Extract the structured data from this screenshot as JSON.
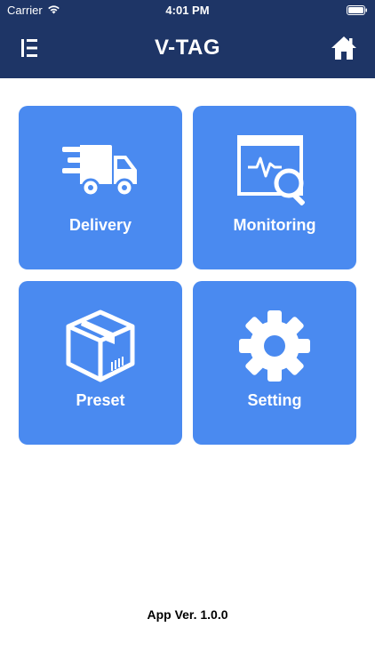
{
  "status_bar": {
    "carrier": "Carrier",
    "time": "4:01 PM",
    "wifi_icon": "wifi-icon",
    "battery_icon": "battery-icon"
  },
  "header": {
    "title": "V-TAG",
    "menu_icon": "menu-icon",
    "home_icon": "home-icon",
    "background_color": "#1e3566"
  },
  "tiles": [
    {
      "label": "Delivery",
      "icon": "truck-icon"
    },
    {
      "label": "Monitoring",
      "icon": "monitor-search-icon"
    },
    {
      "label": "Preset",
      "icon": "package-box-icon"
    },
    {
      "label": "Setting",
      "icon": "gear-icon"
    }
  ],
  "tile_color": "#4a8af0",
  "footer": {
    "version": "App Ver. 1.0.0"
  }
}
